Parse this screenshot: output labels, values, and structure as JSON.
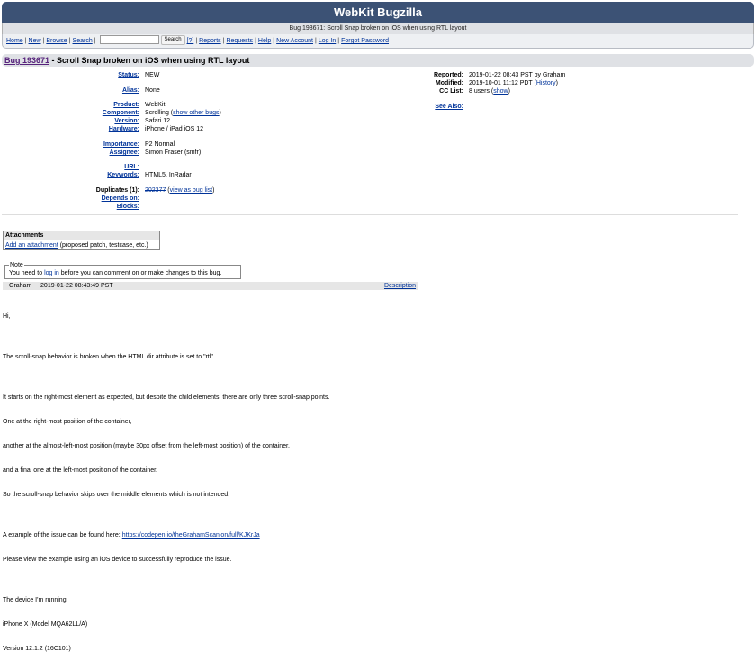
{
  "header": {
    "site_title": "WebKit Bugzilla",
    "subtitle": "Bug 193671: Scroll Snap broken on iOS when using RTL layout",
    "links_left": [
      "Home",
      "New",
      "Browse",
      "Search"
    ],
    "search_button": "Search",
    "search_help": "[?]",
    "links_right": [
      "Reports",
      "Requests",
      "Help",
      "New Account",
      "Log In",
      "Forgot Password"
    ]
  },
  "bug": {
    "id_link": "Bug 193671",
    "title": " - Scroll Snap broken on iOS when using RTL layout"
  },
  "fields": {
    "status_label": "Status:",
    "status": "NEW",
    "alias_label": "Alias:",
    "alias": "None",
    "product_label": "Product:",
    "product": "WebKit",
    "component_label": "Component:",
    "component": "Scrolling (",
    "component_link": "show other bugs",
    "component_end": ")",
    "version_label": "Version:",
    "version": "Safari 12",
    "hardware_label": "Hardware:",
    "hardware": "iPhone / iPad iOS 12",
    "importance_label": "Importance:",
    "importance": "P2 Normal",
    "assignee_label": "Assignee:",
    "assignee": "Simon Fraser (smfr)",
    "url_label": "URL:",
    "keywords_label": "Keywords:",
    "keywords": "HTML5, InRadar",
    "duplicates_label": "Duplicates (1):",
    "duplicate_id": "202377",
    "duplicate_pre": " (",
    "duplicate_link": "view as bug list",
    "duplicate_end": ")",
    "depends_label": "Depends on:",
    "blocks_label": "Blocks:"
  },
  "meta": {
    "reported_label": "Reported:",
    "reported": "2019-01-22 08:43 PST by Graham",
    "modified_label": "Modified:",
    "modified_pre": "2019-10-01 11:12 PDT (",
    "history_link": "History",
    "modified_end": ")",
    "cc_label": "CC List:",
    "cc_pre": "8 users (",
    "cc_link": "show",
    "cc_end": ")",
    "see_also_label": "See Also:"
  },
  "attachments": {
    "heading": "Attachments",
    "add_link": "Add an attachment",
    "add_hint": " (proposed patch, testcase, etc.)"
  },
  "note": {
    "legend": "Note",
    "pre": "You need to ",
    "login_link": "log in",
    "post": " before you can comment on or make changes to this bug."
  },
  "comment": {
    "author": "Graham",
    "timestamp": "2019-01-22 08:43:49 PST",
    "description_link": "Description",
    "lines": [
      "Hi,",
      "",
      "The scroll-snap behavior is broken when the HTML dir attribute is set to \"rtl\"",
      "",
      "It starts on the right-most element as expected, but despite the child elements, there are only three scroll-snap points.",
      "One at the right-most position of the container,",
      "another at the almost-left-most position (maybe 30px offset from the left-most position) of the container,",
      "and a final one at the left-most position of the container.",
      "So the scroll-snap behavior skips over the middle elements which is not intended.",
      "",
      "A example of the issue can be found here: ",
      "Please view the example using an iOS device to successfully reproduce the issue.",
      "",
      "The device I'm running:",
      "iPhone X (Model MQA62LL/A)",
      "Version 12.1.2 (16C101)"
    ],
    "example_url": "https://codepen.io/theGrahamScanlon/full/KJKrJa"
  }
}
